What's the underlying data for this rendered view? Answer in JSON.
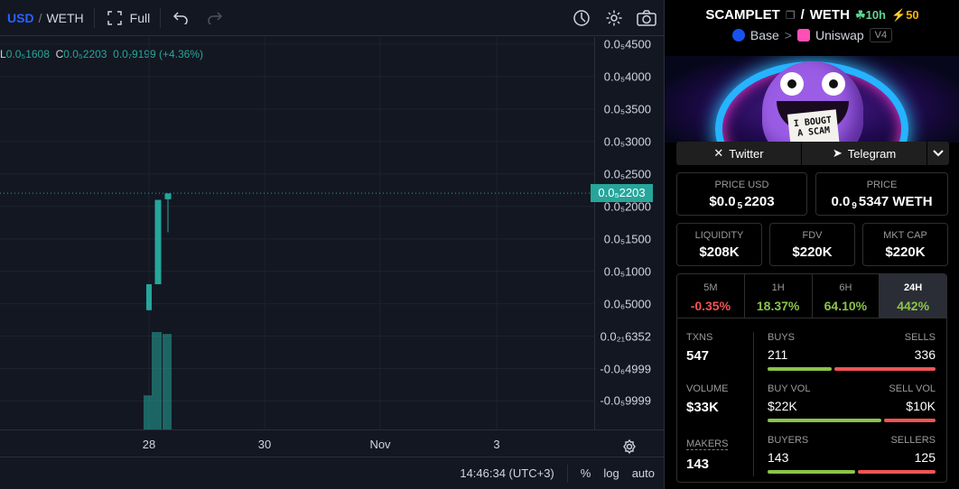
{
  "toolbar": {
    "quote_primary": "USD",
    "separator": "/",
    "quote_secondary": "WETH",
    "full_label": "Full",
    "icons": [
      "fullscreen-icon",
      "undo-icon",
      "redo-icon",
      "indicator-icon",
      "gear-icon",
      "camera-icon"
    ]
  },
  "legend": {
    "l_key": "L",
    "l_value": "0.0₅1608",
    "c_key": "C",
    "c_value": "0.0₅2203",
    "change": "0.0₇9199 (+4.36%)"
  },
  "price_axis": {
    "ticks": [
      "0.0₅4500",
      "0.0₅4000",
      "0.0₅3500",
      "0.0₅3000",
      "0.0₅2500",
      "0.0₅2000",
      "0.0₅1500",
      "0.0₅1000",
      "0.0₆5000",
      "0.0₂₁6352",
      "-0.0₆4999",
      "-0.0₅9999"
    ],
    "current_badge": "0.0₅2203"
  },
  "time_axis": {
    "ticks": [
      "28",
      "30",
      "Nov",
      "3"
    ]
  },
  "status_bar": {
    "clock": "14:46:34 (UTC+3)",
    "percent_label": "%",
    "log_label": "log",
    "auto_label": "auto"
  },
  "chart_data": {
    "type": "candlestick",
    "y_units": "USD (×1e-5)",
    "candles": [
      {
        "open": 0.4,
        "close": 0.8,
        "high": 0.8,
        "low": 0.4
      },
      {
        "open": 0.8,
        "close": 2.1,
        "high": 2.1,
        "low": 0.8
      },
      {
        "open": 2.11,
        "close": 2.2,
        "high": 2.2,
        "low": 1.6
      }
    ],
    "volume_bars": [
      0.35,
      1.0,
      0.98
    ],
    "current_price": 2.203
  },
  "pair": {
    "base": "SCAMPLET",
    "slash": "/",
    "quote": "WETH",
    "age": "10h",
    "boost": "50",
    "chain": "Base",
    "chevron": ">",
    "dex": "Uniswap",
    "version": "V4"
  },
  "banner": {
    "sign_text": "I BOUGT A SCAM"
  },
  "social": {
    "twitter": "Twitter",
    "telegram": "Telegram"
  },
  "stats": {
    "price_usd_label": "PRICE USD",
    "price_usd_pre": "$0.0",
    "price_usd_sub": "5",
    "price_usd_post": "2203",
    "price_label": "PRICE",
    "price_pre": "0.0",
    "price_sub": "9",
    "price_post": "5347 WETH",
    "liquidity_label": "LIQUIDITY",
    "liquidity": "$208K",
    "fdv_label": "FDV",
    "fdv": "$220K",
    "mktcap_label": "MKT CAP",
    "mktcap": "$220K"
  },
  "timeframes": [
    {
      "name": "5M",
      "value": "-0.35%",
      "color": "#f05454"
    },
    {
      "name": "1H",
      "value": "18.37%",
      "color": "#8bc34a"
    },
    {
      "name": "6H",
      "value": "64.10%",
      "color": "#8bc34a"
    },
    {
      "name": "24H",
      "value": "442%",
      "color": "#8bc34a"
    }
  ],
  "txn_stats": {
    "txns_label": "TXNS",
    "txns": "547",
    "buys_label": "BUYS",
    "buys": "211",
    "sells_label": "SELLS",
    "sells": "336",
    "buys_share": 0.386,
    "volume_label": "VOLUME",
    "volume": "$33K",
    "buy_vol_label": "BUY VOL",
    "buy_vol": "$22K",
    "sell_vol_label": "SELL VOL",
    "sell_vol": "$10K",
    "buy_vol_share": 0.69,
    "makers_label": "MAKERS",
    "makers": "143",
    "buyers_label": "BUYERS",
    "buyers": "143",
    "sellers_label": "SELLERS",
    "sellers": "125",
    "buyers_share": 0.53
  },
  "colors": {
    "up": "#26a69a",
    "buy": "#8bc34a",
    "sell": "#f05454",
    "accent": "#2962ff"
  }
}
